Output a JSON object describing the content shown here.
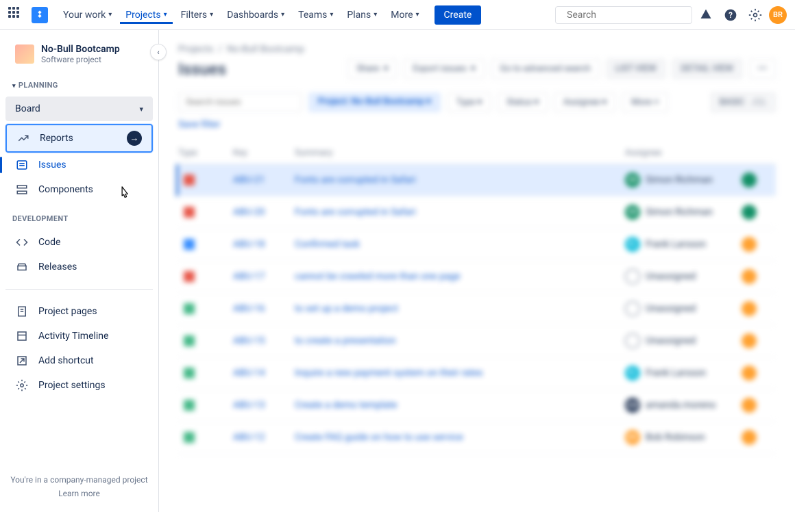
{
  "nav": {
    "your_work": "Your work",
    "projects": "Projects",
    "filters": "Filters",
    "dashboards": "Dashboards",
    "teams": "Teams",
    "plans": "Plans",
    "more": "More",
    "create": "Create"
  },
  "search": {
    "placeholder": "Search"
  },
  "user_initials": "BR",
  "project": {
    "name": "No-Bull Bootcamp",
    "type": "Software project"
  },
  "sidebar": {
    "planning_label": "PLANNING",
    "board": "Board",
    "reports": "Reports",
    "issues": "Issues",
    "components": "Components",
    "development_label": "DEVELOPMENT",
    "code": "Code",
    "releases": "Releases",
    "project_pages": "Project pages",
    "activity": "Activity Timeline",
    "add_shortcut": "Add shortcut",
    "settings": "Project settings"
  },
  "footer": {
    "text": "You're in a company-managed project",
    "learn": "Learn more"
  },
  "breadcrumb": {
    "projects": "Projects",
    "project": "No-Bull Bootcamp"
  },
  "page_title": "Issues",
  "toolbar": {
    "share": "Share",
    "export": "Export issues",
    "advanced": "Go to advanced search",
    "list_view": "LIST VIEW",
    "detail_view": "DETAIL VIEW"
  },
  "filters": {
    "search_placeholder": "Search issues",
    "project_label": "Project:",
    "project_value": "No-Bull Bootcamp",
    "type": "Type",
    "status": "Status",
    "assignee": "Assignee",
    "more": "More",
    "basic": "BASIC",
    "jql": "JQL",
    "save": "Save filter"
  },
  "columns": {
    "type": "Type",
    "key": "Key",
    "summary": "Summary",
    "assignee": "Assignee"
  },
  "rows": [
    {
      "type": "bug",
      "key": "ABU-21",
      "summary": "Fonts are corrupted in Safari",
      "assignee": "Simon Richman",
      "av": "green",
      "rep_av": "green"
    },
    {
      "type": "bug",
      "key": "ABU-20",
      "summary": "Fonts are corrupted in Safari",
      "assignee": "Simon Richman",
      "av": "green",
      "rep_av": "green"
    },
    {
      "type": "task",
      "key": "ABU-18",
      "summary": "Confirmed task",
      "assignee": "Frank Larsson",
      "av": "teal",
      "rep_av": "orange"
    },
    {
      "type": "bug",
      "key": "ABU-17",
      "summary": "cannot be crawled more than one page",
      "assignee": "Unassigned",
      "av": "grey",
      "rep_av": "orange"
    },
    {
      "type": "story",
      "key": "ABU-16",
      "summary": "to set up a demo project",
      "assignee": "Unassigned",
      "av": "grey",
      "rep_av": "orange"
    },
    {
      "type": "story",
      "key": "ABU-15",
      "summary": "to create a presentation",
      "assignee": "Unassigned",
      "av": "grey",
      "rep_av": "orange"
    },
    {
      "type": "story",
      "key": "ABU-14",
      "summary": "Inquire a new payment system on their rates",
      "assignee": "Frank Larsson",
      "av": "teal",
      "rep_av": "orange"
    },
    {
      "type": "story",
      "key": "ABU-13",
      "summary": "Create a demo template",
      "assignee": "amanda.moreno",
      "av": "dark",
      "rep_av": "orange"
    },
    {
      "type": "story",
      "key": "ABU-12",
      "summary": "Create FAQ guide on how to use service",
      "assignee": "Bob Robinson",
      "av": "orange",
      "rep_av": "orange"
    }
  ]
}
